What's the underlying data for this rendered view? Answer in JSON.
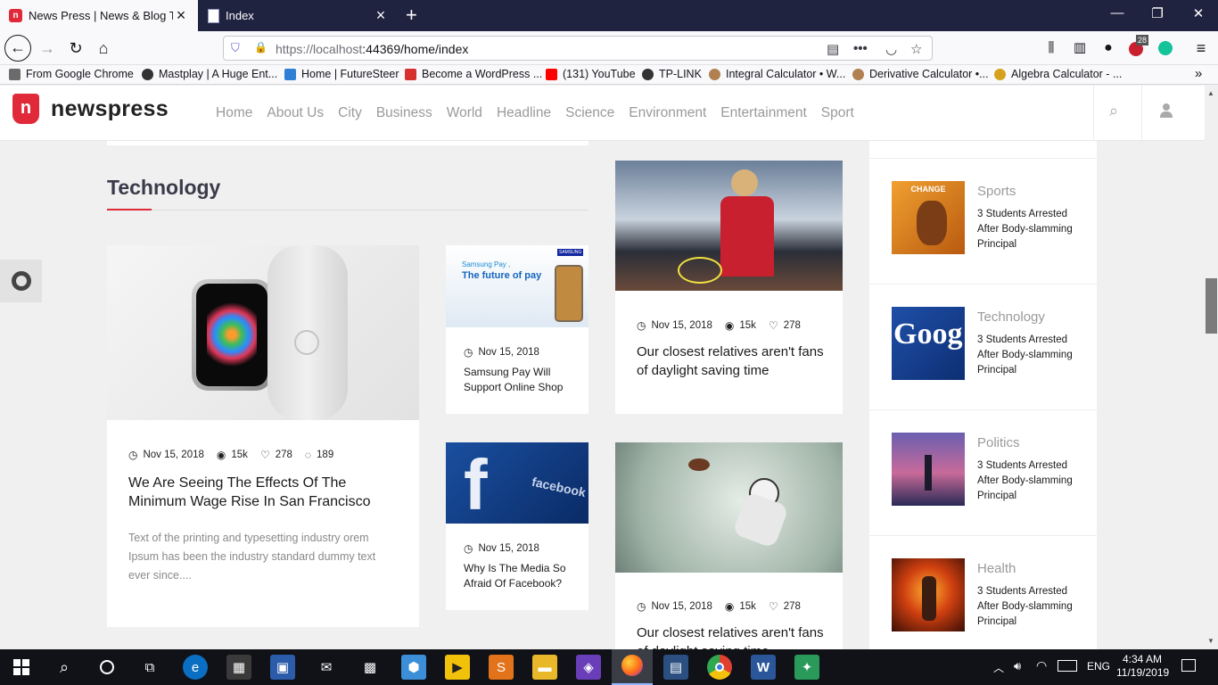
{
  "browser": {
    "tabs": [
      {
        "title": "News Press | News & Blog Temp"
      },
      {
        "title": "Index"
      }
    ],
    "url_host": "https://localhost",
    "url_path": ":44369/home/index",
    "bookmarks": [
      {
        "label": "From Google Chrome",
        "color": "#6b6b6b"
      },
      {
        "label": "Mastplay | A Huge Ent...",
        "color": "#333333"
      },
      {
        "label": "Home | FutureSteer",
        "color": "#2f7fd6"
      },
      {
        "label": "Become a WordPress ...",
        "color": "#d6302f"
      },
      {
        "label": "(131) YouTube",
        "color": "#ff0000"
      },
      {
        "label": "TP-LINK",
        "color": "#333333"
      },
      {
        "label": "Integral Calculator • W...",
        "color": "#b08050"
      },
      {
        "label": "Derivative Calculator •...",
        "color": "#b08050"
      },
      {
        "label": "Algebra Calculator - ...",
        "color": "#d6a21e"
      }
    ],
    "badge_count": "28"
  },
  "site": {
    "logo_text": "newspress",
    "logo_mark": "n",
    "nav": [
      "Home",
      "About Us",
      "City",
      "Business",
      "World",
      "Headline",
      "Science",
      "Environment",
      "Entertainment",
      "Sport"
    ]
  },
  "section": {
    "title": "Technology"
  },
  "main_post": {
    "date": "Nov 15, 2018",
    "views": "15k",
    "likes": "278",
    "comments": "189",
    "title": "We Are Seeing The Effects Of The Minimum Wage Rise In San Francisco",
    "excerpt": "Text of the printing and typesetting industry orem Ipsum has been the industry standard dummy text ever since...."
  },
  "small_posts": [
    {
      "date": "Nov 15, 2018",
      "title": "Samsung Pay Will Support Online Shop",
      "img_caption_1": "Samsung Pay ,",
      "img_caption_2": "The future of pay",
      "img_brand": "SAMSUNG"
    },
    {
      "date": "Nov 15, 2018",
      "title": "Why Is The Media So Afraid Of Facebook?",
      "img_text": "facebook"
    }
  ],
  "mid_posts": [
    {
      "date": "Nov 15, 2018",
      "views": "15k",
      "likes": "278",
      "title": "Our closest relatives aren't fans of daylight saving time"
    },
    {
      "date": "Nov 15, 2018",
      "views": "15k",
      "likes": "278",
      "title": "Our closest relatives aren't fans of daylight saving time"
    }
  ],
  "sidebar": [
    {
      "category": "Sports",
      "title": "3 Students Arrested After Body-slamming Principal",
      "img_text": "CHANGE"
    },
    {
      "category": "Technology",
      "title": "3 Students Arrested After Body-slamming Principal",
      "img_text": "Goog"
    },
    {
      "category": "Politics",
      "title": "3 Students Arrested After Body-slamming Principal"
    },
    {
      "category": "Health",
      "title": "3 Students Arrested After Body-slamming Principal"
    }
  ],
  "taskbar": {
    "language": "ENG",
    "time": "4:34 AM",
    "date": "11/19/2019"
  },
  "colors": {
    "accent": "#e02a3a",
    "tab_bar": "#202340",
    "taskbar": "#101218"
  }
}
